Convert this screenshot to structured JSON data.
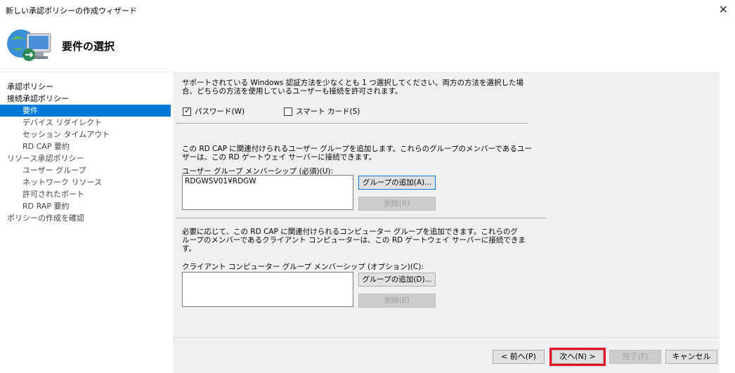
{
  "window": {
    "title": "新しい承認ポリシーの作成ウィザード",
    "close_glyph": "✕"
  },
  "header": {
    "title": "要件の選択"
  },
  "nav": [
    {
      "label": "承認ポリシー",
      "level": 0
    },
    {
      "label": "接続承認ポリシー",
      "level": 0
    },
    {
      "label": "要件",
      "level": 1,
      "selected": true
    },
    {
      "label": "デバイス リダイレクト",
      "level": 1
    },
    {
      "label": "セッション タイムアウト",
      "level": 1
    },
    {
      "label": "RD CAP 要約",
      "level": 1
    },
    {
      "label": "リソース承認ポリシー",
      "level": 0
    },
    {
      "label": "ユーザー グループ",
      "level": 1
    },
    {
      "label": "ネットワーク リソース",
      "level": 1
    },
    {
      "label": "許可されたポート",
      "level": 1
    },
    {
      "label": "RD RAP 要約",
      "level": 1
    },
    {
      "label": "ポリシーの作成を確認",
      "level": 0
    }
  ],
  "auth": {
    "desc_line1": "サポートされている Windows 認証方法を少なくとも 1 つ選択してください。両方の方法を選択した場",
    "desc_line2": "合、どちらの方法を使用しているユーザーも接続を許可されます。",
    "password_label": "パスワード(W)",
    "password_checked": true,
    "smartcard_label": "スマート カード(S)",
    "smartcard_checked": false
  },
  "user_groups": {
    "desc_line1": "この RD CAP に関連付けられるユーザー グループを追加します。これらのグループのメンバーであるユー",
    "desc_line2": "ザーは、この RD ゲートウェイ サーバーに接続できます。",
    "list_label": "ユーザー グループ メンバーシップ (必須)(U):",
    "items": [
      "RDGWSV01¥RDGW"
    ],
    "add_label": "グループの追加(A)...",
    "remove_label": "削除(R)"
  },
  "computer_groups": {
    "desc_line1": "必要に応じて、この RD CAP に関連付けられるコンピューター グループを追加できます。これらのグ",
    "desc_line2": "ループのメンバーであるクライアント コンピューターは、この RD ゲートウェイ サーバーに接続できま",
    "desc_line3": "す。",
    "list_label": "クライアント コンピューター グループ メンバーシップ (オプション)(C):",
    "items": [],
    "add_label": "グループの追加(D)...",
    "remove_label": "削除(E)"
  },
  "footer": {
    "back_label": "< 前へ(P)",
    "next_label": "次へ(N) >",
    "finish_label": "完了(F)",
    "cancel_label": "キャンセル"
  },
  "colors": {
    "selection": "#0078d7",
    "highlight": "#e81123"
  },
  "icons": [
    "remote-connection-icon",
    "close-icon",
    "checkmark-icon"
  ]
}
